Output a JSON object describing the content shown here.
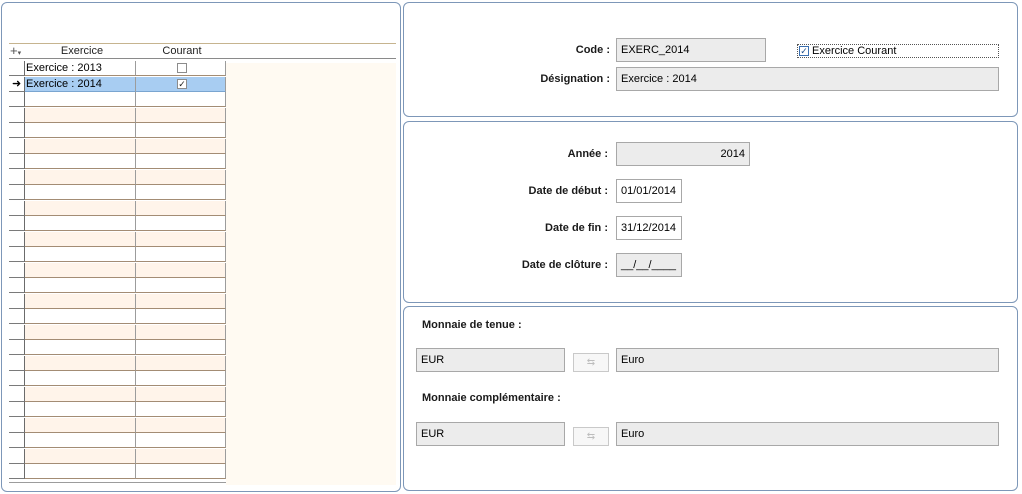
{
  "grid": {
    "add_icon": "add-row-icon",
    "columns": [
      "Exercice",
      "Courant"
    ],
    "rows": [
      {
        "label": "Exercice : 2013",
        "courant": false,
        "selected": false
      },
      {
        "label": "Exercice : 2014",
        "courant": true,
        "selected": true
      }
    ],
    "current_row_marker": "➜"
  },
  "code_section": {
    "code_label": "Code :",
    "code_value": "EXERC_2014",
    "courant_checkbox_label": "Exercice Courant",
    "courant_checked": true,
    "designation_label": "Désignation :",
    "designation_value": "Exercice : 2014"
  },
  "dates_section": {
    "annee_label": "Année :",
    "annee_value": "2014",
    "debut_label": "Date de début :",
    "debut_value": "01/01/2014",
    "fin_label": "Date de fin :",
    "fin_value": "31/12/2014",
    "cloture_label": "Date de clôture :",
    "cloture_value": "__/__/____"
  },
  "currency_section": {
    "tenue_label": "Monnaie de tenue :",
    "tenue_code": "EUR",
    "tenue_name": "Euro",
    "complementaire_label": "Monnaie complémentaire :",
    "complementaire_code": "EUR",
    "complementaire_name": "Euro",
    "lookup_glyph": "⇆"
  }
}
